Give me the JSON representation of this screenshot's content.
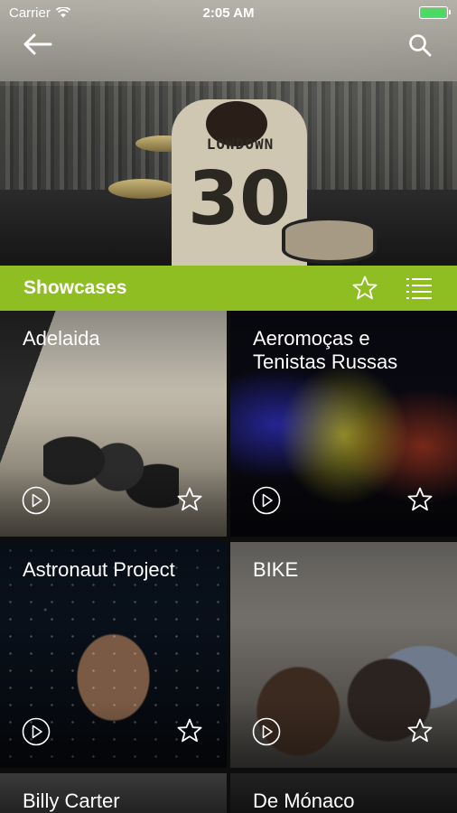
{
  "status_bar": {
    "carrier": "Carrier",
    "time": "2:05 AM",
    "battery_color": "#4cd964"
  },
  "header": {
    "back_icon": "arrow-left-icon",
    "search_icon": "search-icon",
    "hero_shirt_text": "LOWDOWN",
    "hero_shirt_number": "30"
  },
  "section": {
    "title": "Showcases",
    "accent_color": "#8fbe22",
    "favorite_icon": "star-outline-icon",
    "list_icon": "list-icon"
  },
  "showcases": [
    {
      "title": "Adelaida"
    },
    {
      "title": "Aeromoças e Tenistas Russas"
    },
    {
      "title": "Astronaut Project"
    },
    {
      "title": "BIKE"
    },
    {
      "title": "Billy Carter"
    },
    {
      "title": "De Mónaco"
    }
  ]
}
